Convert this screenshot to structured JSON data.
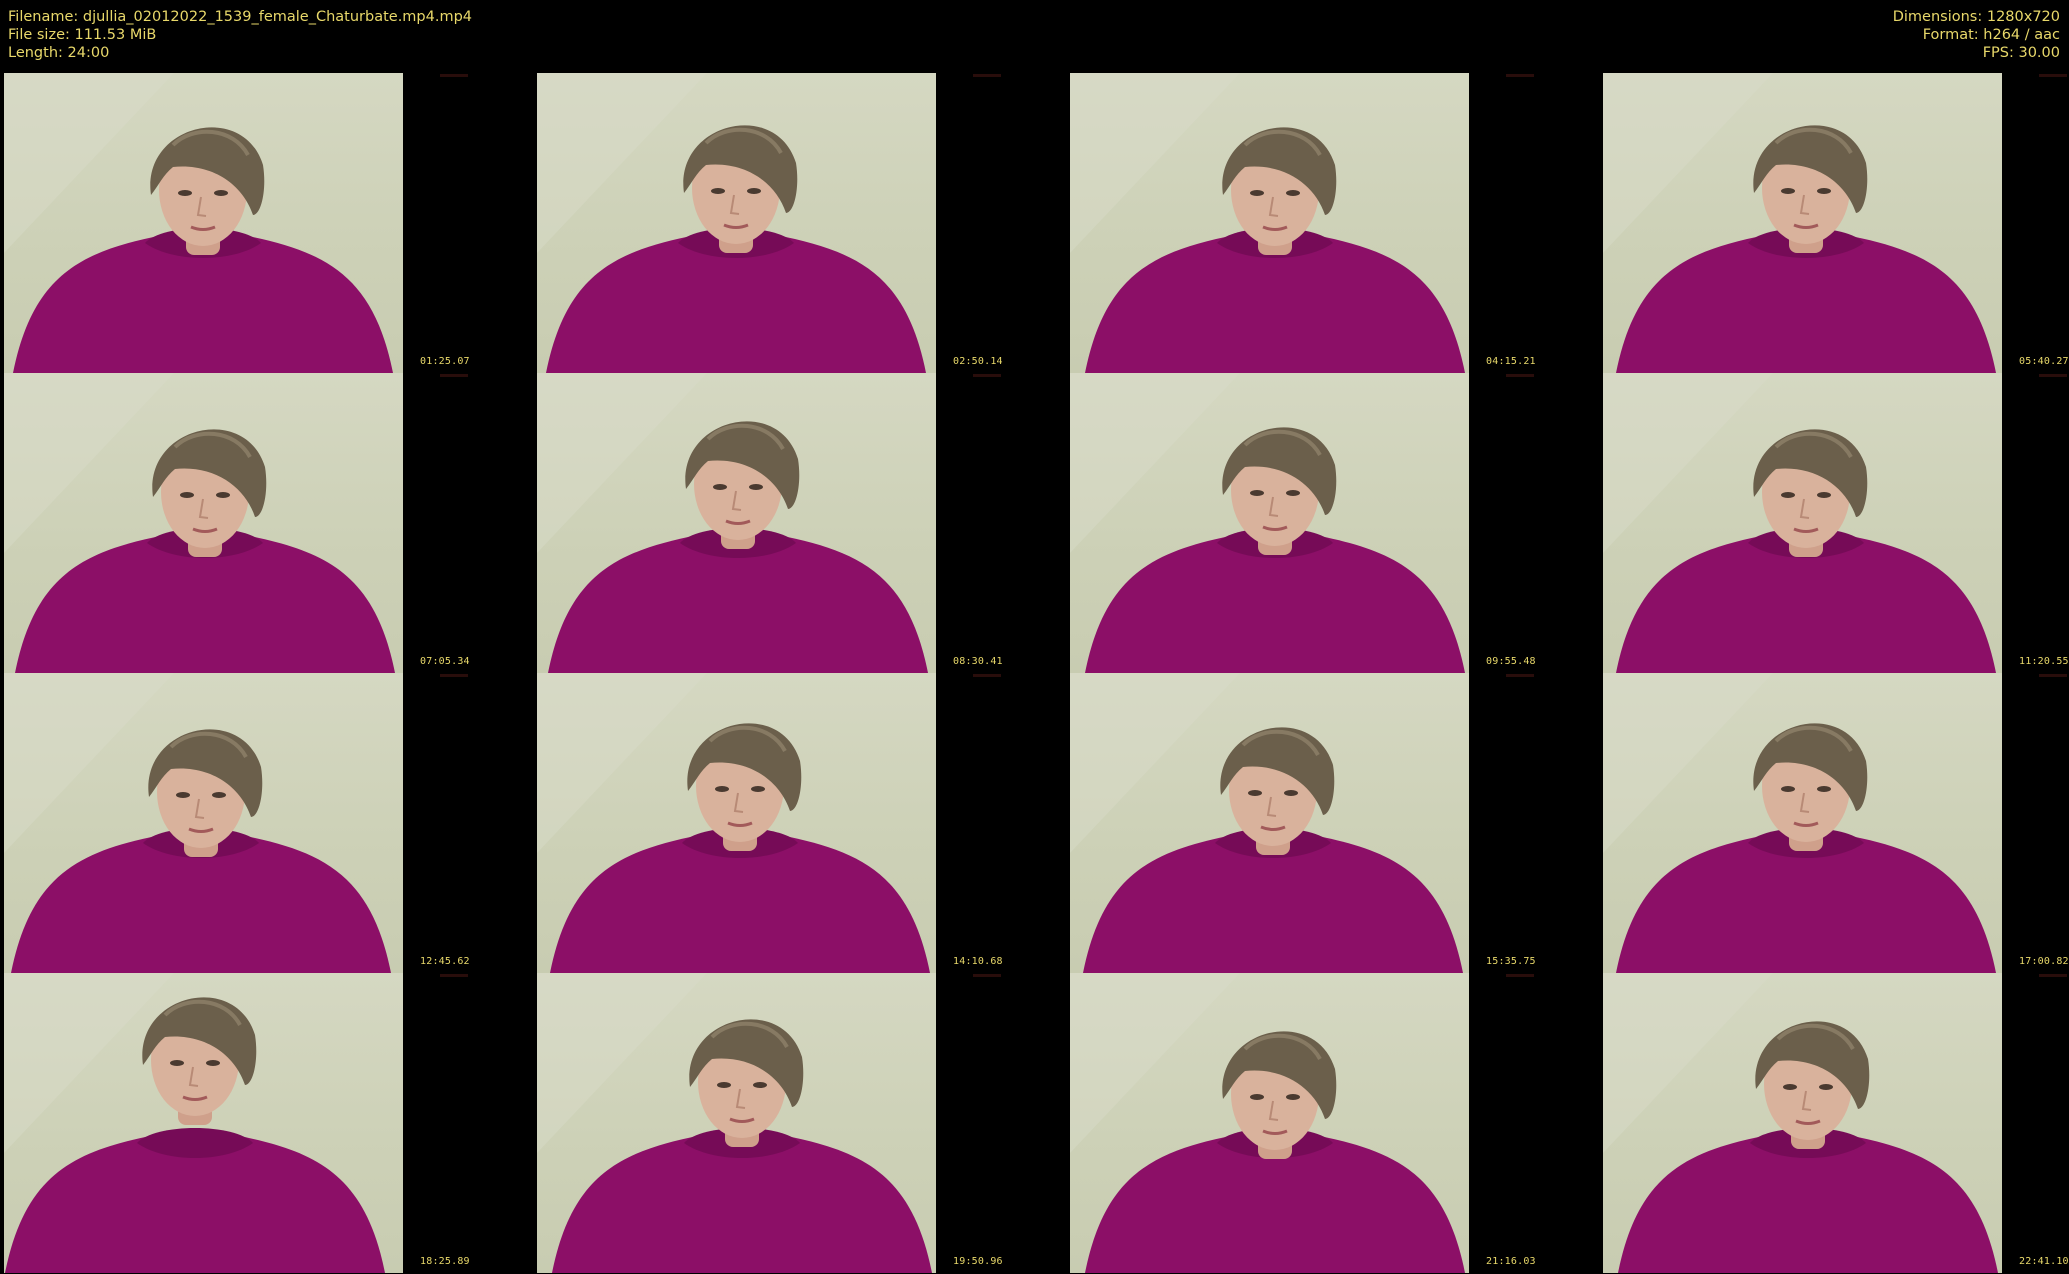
{
  "info": {
    "filename": "Filename: djullia_02012022_1539_female_Chaturbate.mp4.mp4",
    "filesize": "File size: 111.53 MiB",
    "length": "Length: 24:00",
    "dimensions": "Dimensions: 1280x720",
    "format": "Format: h264 / aac",
    "fps": "FPS: 30.00"
  },
  "colors": {
    "text": "#e8d86a",
    "background": "#000000",
    "wall": "#cdd1b7",
    "hoodie": "#8c0f67",
    "hair": "#6b5f4b",
    "skin": "#d9b29c"
  },
  "frames": [
    {
      "timestamp": "01:25.07"
    },
    {
      "timestamp": "02:50.14"
    },
    {
      "timestamp": "04:15.21"
    },
    {
      "timestamp": "05:40.27"
    },
    {
      "timestamp": "07:05.34"
    },
    {
      "timestamp": "08:30.41"
    },
    {
      "timestamp": "09:55.48"
    },
    {
      "timestamp": "11:20.55"
    },
    {
      "timestamp": "12:45.62"
    },
    {
      "timestamp": "14:10.68"
    },
    {
      "timestamp": "15:35.75"
    },
    {
      "timestamp": "17:00.82"
    },
    {
      "timestamp": "18:25.89"
    },
    {
      "timestamp": "19:50.96"
    },
    {
      "timestamp": "21:16.03"
    },
    {
      "timestamp": "22:41.10"
    }
  ]
}
